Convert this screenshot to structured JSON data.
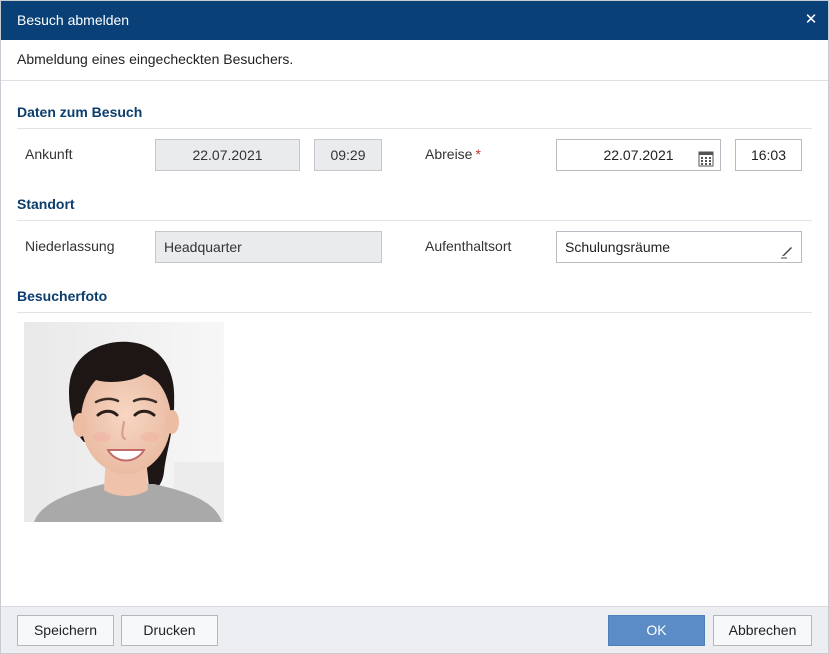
{
  "dialog": {
    "title": "Besuch abmelden",
    "close_glyph": "✕",
    "subtitle": "Abmeldung eines eingecheckten Besuchers."
  },
  "visit": {
    "section_title": "Daten zum Besuch",
    "arrival_label": "Ankunft",
    "arrival_date": "22.07.2021",
    "arrival_time": "09:29",
    "departure_label": "Abreise",
    "departure_required": "*",
    "departure_date": "22.07.2021",
    "departure_time": "16:03"
  },
  "location": {
    "section_title": "Standort",
    "branch_label": "Niederlassung",
    "branch_value": "Headquarter",
    "stay_label": "Aufenthaltsort",
    "stay_value": "Schulungsräume"
  },
  "photo": {
    "section_title": "Besucherfoto"
  },
  "footer": {
    "save_label": "Speichern",
    "print_label": "Drucken",
    "ok_label": "OK",
    "cancel_label": "Abbrechen"
  },
  "colors": {
    "titlebar": "#0a4078",
    "section_title": "#0b3d6d",
    "primary_button": "#5b8cc6",
    "required_marker": "#c0392b"
  },
  "icons": {
    "close": "close-icon",
    "calendar": "calendar-icon",
    "edit": "pencil-icon"
  }
}
